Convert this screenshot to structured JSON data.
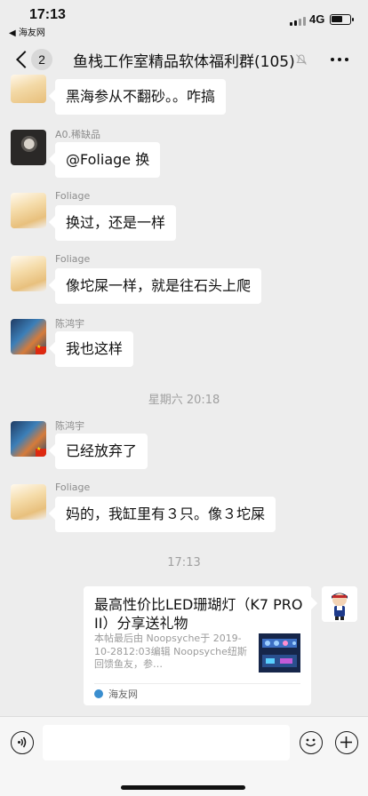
{
  "status_bar": {
    "time": "17:13",
    "back_app": "◀ 海友网",
    "network": "4G"
  },
  "nav": {
    "badge": "2",
    "title": "鱼栈工作室精品软体福利群(105)"
  },
  "messages": [
    {
      "text": "黑海参从不翻砂。。咋搞"
    },
    {
      "sender": "A0.稀缺品",
      "text": "@Foliage 换"
    },
    {
      "sender": "Foliage",
      "text": "换过，还是一样"
    },
    {
      "sender": "Foliage",
      "text": "像坨屎一样，就是往石头上爬"
    },
    {
      "sender": "陈鸿宇",
      "text": "我也这样"
    },
    {
      "sender": "陈鸿宇",
      "text": "已经放弃了"
    },
    {
      "sender": "Foliage",
      "text": "妈的，我缸里有３只。像３坨屎"
    }
  ],
  "timestamps": [
    "星期六 20:18",
    "17:13"
  ],
  "link_card": {
    "title": "最高性价比LED珊瑚灯（K7 PRO II）分享送礼物",
    "description": "本帖最后由 Noopsyche于 2019-10-2812:03编辑 Noopsyche纽斯回馈鱼友，参…",
    "source": "海友网"
  },
  "colors": {
    "background": "#ededed",
    "bubble": "#ffffff",
    "meta_text": "#8c8c8c"
  }
}
